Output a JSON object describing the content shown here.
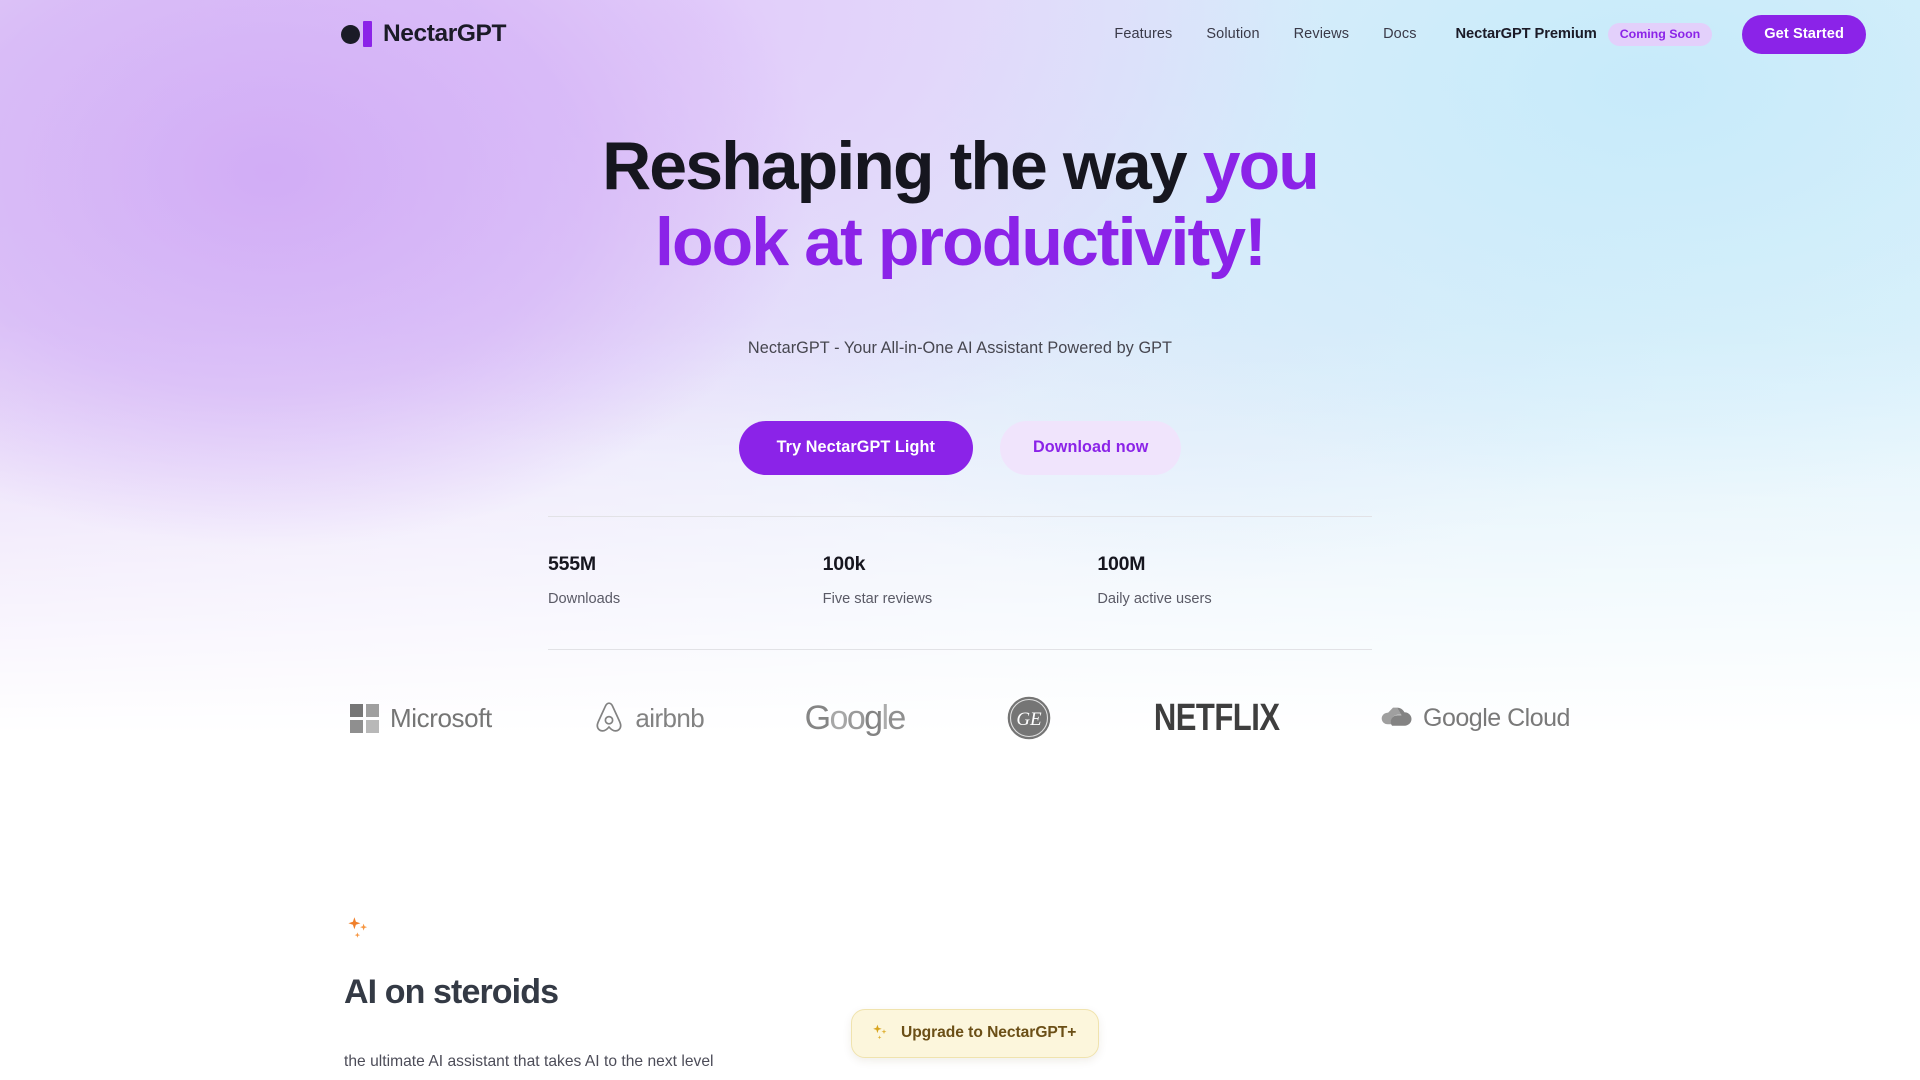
{
  "brand": {
    "name": "NectarGPT",
    "dot_color": "#1b1b27",
    "bar_color": "#8b23e8"
  },
  "nav": {
    "links": [
      {
        "label": "Features"
      },
      {
        "label": "Solution"
      },
      {
        "label": "Reviews"
      },
      {
        "label": "Docs"
      }
    ],
    "premium_label": "NectarGPT Premium",
    "premium_badge": "Coming Soon",
    "cta_label": "Get Started",
    "accent_color": "#8b23e8",
    "badge_bg": "#e3d0fb"
  },
  "hero": {
    "heading_line1_plain": "Reshaping the way ",
    "heading_line1_accent": "you",
    "heading_line2_accent": "look at productivity!",
    "subtitle": "NectarGPT - Your All-in-One AI Assistant Powered by GPT",
    "primary_cta": "Try NectarGPT Light",
    "secondary_cta": "Download now"
  },
  "stats": [
    {
      "value": "555M",
      "label": "Downloads"
    },
    {
      "value": "100k",
      "label": "Five star reviews"
    },
    {
      "value": "100M",
      "label": "Daily active users"
    }
  ],
  "logos": [
    {
      "name": "Microsoft",
      "icon": "microsoft-logo"
    },
    {
      "name": "airbnb",
      "icon": "airbnb-logo"
    },
    {
      "name": "Google",
      "icon": "google-logo"
    },
    {
      "name": "GE",
      "icon": "ge-logo"
    },
    {
      "name": "NETFLIX",
      "icon": "netflix-logo"
    },
    {
      "name": "Google Cloud",
      "icon": "google-cloud-logo"
    }
  ],
  "google_letters": [
    "G",
    "o",
    "o",
    "g",
    "l",
    "e"
  ],
  "feature": {
    "sparkle_icon": "sparkles-icon",
    "heading": "AI on steroids",
    "body": "the ultimate AI assistant that takes AI to the next level"
  },
  "upgrade_chip": {
    "icon": "sparkles-icon",
    "label": "Upgrade to NectarGPT+",
    "bg": "#fcf6dc",
    "text_color": "#6b4f16"
  }
}
